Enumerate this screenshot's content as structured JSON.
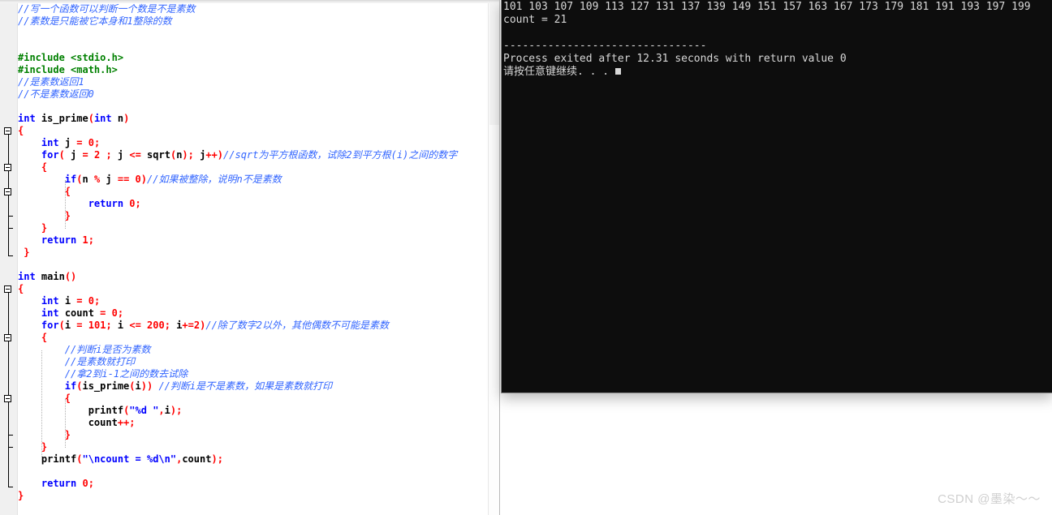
{
  "editor": {
    "name": "code-editor",
    "language": "C",
    "colors": {
      "background": "#ffffff",
      "gutter": "#f0f0f0",
      "keyword": "#0000ff",
      "preprocessor": "#008000",
      "punctuation": "#ff0000",
      "string": "#0000ff",
      "comment": "#3366ff",
      "text": "#000000"
    },
    "lines": [
      {
        "indent": 0,
        "tokens": [
          {
            "t": "//写一个函数可以判断一个数是不是素数",
            "c": "com"
          }
        ]
      },
      {
        "indent": 0,
        "tokens": [
          {
            "t": "//素数是只能被它本身和1整除的数",
            "c": "com"
          }
        ]
      },
      {
        "indent": 0,
        "tokens": []
      },
      {
        "indent": 0,
        "tokens": []
      },
      {
        "indent": 0,
        "tokens": [
          {
            "t": "#include <stdio.h>",
            "c": "pre"
          }
        ]
      },
      {
        "indent": 0,
        "tokens": [
          {
            "t": "#include <math.h>",
            "c": "pre"
          }
        ]
      },
      {
        "indent": 0,
        "tokens": [
          {
            "t": "//是素数返回1",
            "c": "com"
          }
        ]
      },
      {
        "indent": 0,
        "tokens": [
          {
            "t": "//不是素数返回0",
            "c": "com"
          }
        ]
      },
      {
        "indent": 0,
        "tokens": []
      },
      {
        "indent": 0,
        "tokens": [
          {
            "t": "int",
            "c": "kw"
          },
          {
            "t": " is_prime",
            "c": "fn"
          },
          {
            "t": "(",
            "c": "punc"
          },
          {
            "t": "int",
            "c": "kw"
          },
          {
            "t": " n",
            "c": "fn"
          },
          {
            "t": ")",
            "c": "punc"
          }
        ]
      },
      {
        "indent": 0,
        "tokens": [
          {
            "t": "{",
            "c": "punc"
          }
        ]
      },
      {
        "indent": 1,
        "tokens": [
          {
            "t": "int",
            "c": "kw"
          },
          {
            "t": " j ",
            "c": "fn"
          },
          {
            "t": "=",
            "c": "op"
          },
          {
            "t": " ",
            "c": "fn"
          },
          {
            "t": "0",
            "c": "num"
          },
          {
            "t": ";",
            "c": "punc"
          }
        ]
      },
      {
        "indent": 1,
        "tokens": [
          {
            "t": "for",
            "c": "kw"
          },
          {
            "t": "(",
            "c": "punc"
          },
          {
            "t": " j ",
            "c": "fn"
          },
          {
            "t": "=",
            "c": "op"
          },
          {
            "t": " ",
            "c": "fn"
          },
          {
            "t": "2",
            "c": "num"
          },
          {
            "t": " ",
            "c": "fn"
          },
          {
            "t": ";",
            "c": "punc"
          },
          {
            "t": " j ",
            "c": "fn"
          },
          {
            "t": "<=",
            "c": "op"
          },
          {
            "t": " sqrt",
            "c": "fn"
          },
          {
            "t": "(",
            "c": "punc"
          },
          {
            "t": "n",
            "c": "fn"
          },
          {
            "t": ")",
            "c": "punc"
          },
          {
            "t": ";",
            "c": "punc"
          },
          {
            "t": " j",
            "c": "fn"
          },
          {
            "t": "++)",
            "c": "punc"
          },
          {
            "t": "//sqrt为平方根函数，试除2到平方根(i)之间的数字",
            "c": "com"
          }
        ]
      },
      {
        "indent": 1,
        "tokens": [
          {
            "t": "{",
            "c": "punc"
          }
        ]
      },
      {
        "indent": 2,
        "tokens": [
          {
            "t": "if",
            "c": "kw"
          },
          {
            "t": "(",
            "c": "punc"
          },
          {
            "t": "n ",
            "c": "fn"
          },
          {
            "t": "%",
            "c": "op"
          },
          {
            "t": " j ",
            "c": "fn"
          },
          {
            "t": "==",
            "c": "op"
          },
          {
            "t": " ",
            "c": "fn"
          },
          {
            "t": "0",
            "c": "num"
          },
          {
            "t": ")",
            "c": "punc"
          },
          {
            "t": "//如果被整除，说明n不是素数",
            "c": "com"
          }
        ]
      },
      {
        "indent": 2,
        "tokens": [
          {
            "t": "{",
            "c": "punc"
          }
        ]
      },
      {
        "indent": 3,
        "tokens": [
          {
            "t": "return",
            "c": "kw"
          },
          {
            "t": " ",
            "c": "fn"
          },
          {
            "t": "0",
            "c": "num"
          },
          {
            "t": ";",
            "c": "punc"
          }
        ]
      },
      {
        "indent": 2,
        "tokens": [
          {
            "t": "}",
            "c": "punc"
          }
        ]
      },
      {
        "indent": 1,
        "tokens": [
          {
            "t": "}",
            "c": "punc"
          }
        ]
      },
      {
        "indent": 1,
        "tokens": [
          {
            "t": "return",
            "c": "kw"
          },
          {
            "t": " ",
            "c": "fn"
          },
          {
            "t": "1",
            "c": "num"
          },
          {
            "t": ";",
            "c": "punc"
          }
        ]
      },
      {
        "indent": 0,
        "tokens": [
          {
            "t": " }",
            "c": "punc"
          }
        ]
      },
      {
        "indent": 0,
        "tokens": []
      },
      {
        "indent": 0,
        "tokens": [
          {
            "t": "int",
            "c": "kw"
          },
          {
            "t": " main",
            "c": "fn"
          },
          {
            "t": "()",
            "c": "punc"
          }
        ]
      },
      {
        "indent": 0,
        "tokens": [
          {
            "t": "{",
            "c": "punc"
          }
        ]
      },
      {
        "indent": 1,
        "tokens": [
          {
            "t": "int",
            "c": "kw"
          },
          {
            "t": " i ",
            "c": "fn"
          },
          {
            "t": "=",
            "c": "op"
          },
          {
            "t": " ",
            "c": "fn"
          },
          {
            "t": "0",
            "c": "num"
          },
          {
            "t": ";",
            "c": "punc"
          }
        ]
      },
      {
        "indent": 1,
        "tokens": [
          {
            "t": "int",
            "c": "kw"
          },
          {
            "t": " count ",
            "c": "fn"
          },
          {
            "t": "=",
            "c": "op"
          },
          {
            "t": " ",
            "c": "fn"
          },
          {
            "t": "0",
            "c": "num"
          },
          {
            "t": ";",
            "c": "punc"
          }
        ]
      },
      {
        "indent": 1,
        "tokens": [
          {
            "t": "for",
            "c": "kw"
          },
          {
            "t": "(",
            "c": "punc"
          },
          {
            "t": "i ",
            "c": "fn"
          },
          {
            "t": "=",
            "c": "op"
          },
          {
            "t": " ",
            "c": "fn"
          },
          {
            "t": "101",
            "c": "num"
          },
          {
            "t": ";",
            "c": "punc"
          },
          {
            "t": " i ",
            "c": "fn"
          },
          {
            "t": "<=",
            "c": "op"
          },
          {
            "t": " ",
            "c": "fn"
          },
          {
            "t": "200",
            "c": "num"
          },
          {
            "t": ";",
            "c": "punc"
          },
          {
            "t": " i",
            "c": "fn"
          },
          {
            "t": "+=",
            "c": "op"
          },
          {
            "t": "2",
            "c": "num"
          },
          {
            "t": ")",
            "c": "punc"
          },
          {
            "t": "//除了数字2以外，其他偶数不可能是素数",
            "c": "com"
          }
        ]
      },
      {
        "indent": 1,
        "tokens": [
          {
            "t": "{",
            "c": "punc"
          }
        ]
      },
      {
        "indent": 2,
        "tokens": [
          {
            "t": "//判断i是否为素数",
            "c": "com"
          }
        ]
      },
      {
        "indent": 2,
        "tokens": [
          {
            "t": "//是素数就打印",
            "c": "com"
          }
        ]
      },
      {
        "indent": 2,
        "tokens": [
          {
            "t": "//拿2到i-1之间的数去试除",
            "c": "com"
          }
        ]
      },
      {
        "indent": 2,
        "tokens": [
          {
            "t": "if",
            "c": "kw"
          },
          {
            "t": "(",
            "c": "punc"
          },
          {
            "t": "is_prime",
            "c": "fn"
          },
          {
            "t": "(",
            "c": "punc"
          },
          {
            "t": "i",
            "c": "fn"
          },
          {
            "t": "))",
            "c": "punc"
          },
          {
            "t": " ",
            "c": "fn"
          },
          {
            "t": "//判断i是不是素数，如果是素数就打印",
            "c": "com"
          }
        ]
      },
      {
        "indent": 2,
        "tokens": [
          {
            "t": "{",
            "c": "punc"
          }
        ]
      },
      {
        "indent": 3,
        "tokens": [
          {
            "t": "printf",
            "c": "fn"
          },
          {
            "t": "(",
            "c": "punc"
          },
          {
            "t": "\"%d \"",
            "c": "str"
          },
          {
            "t": ",",
            "c": "punc"
          },
          {
            "t": "i",
            "c": "fn"
          },
          {
            "t": ")",
            "c": "punc"
          },
          {
            "t": ";",
            "c": "punc"
          }
        ]
      },
      {
        "indent": 3,
        "tokens": [
          {
            "t": "count",
            "c": "fn"
          },
          {
            "t": "++;",
            "c": "punc"
          }
        ]
      },
      {
        "indent": 2,
        "tokens": [
          {
            "t": "}",
            "c": "punc"
          }
        ]
      },
      {
        "indent": 1,
        "tokens": [
          {
            "t": "}",
            "c": "punc"
          }
        ]
      },
      {
        "indent": 1,
        "tokens": [
          {
            "t": "printf",
            "c": "fn"
          },
          {
            "t": "(",
            "c": "punc"
          },
          {
            "t": "\"\\ncount = %d\\n\"",
            "c": "str"
          },
          {
            "t": ",",
            "c": "punc"
          },
          {
            "t": "count",
            "c": "fn"
          },
          {
            "t": ")",
            "c": "punc"
          },
          {
            "t": ";",
            "c": "punc"
          }
        ]
      },
      {
        "indent": 1,
        "tokens": []
      },
      {
        "indent": 1,
        "tokens": [
          {
            "t": "return",
            "c": "kw"
          },
          {
            "t": " ",
            "c": "fn"
          },
          {
            "t": "0",
            "c": "num"
          },
          {
            "t": ";",
            "c": "punc"
          }
        ]
      },
      {
        "indent": 0,
        "tokens": [
          {
            "t": "}",
            "c": "punc"
          }
        ]
      }
    ]
  },
  "console": {
    "name": "program-output-console",
    "background": "#0d0d0d",
    "foreground": "#d8d8d8",
    "primes": [
      101,
      103,
      107,
      109,
      113,
      127,
      131,
      137,
      139,
      149,
      151,
      157,
      163,
      167,
      173,
      179,
      181,
      191,
      193,
      197,
      199
    ],
    "lines": [
      "101 103 107 109 113 127 131 137 139 149 151 157 163 167 173 179 181 191 193 197 199",
      "count = 21",
      "",
      "--------------------------------",
      "Process exited after 12.31 seconds with return value 0",
      "请按任意键继续. . . "
    ],
    "count_label": "count",
    "count_value": "21",
    "exit_time_seconds": "12.31",
    "return_value": "0",
    "press_any_key": "请按任意键继续. . . "
  },
  "watermark": {
    "text": "CSDN @墨染～～"
  }
}
